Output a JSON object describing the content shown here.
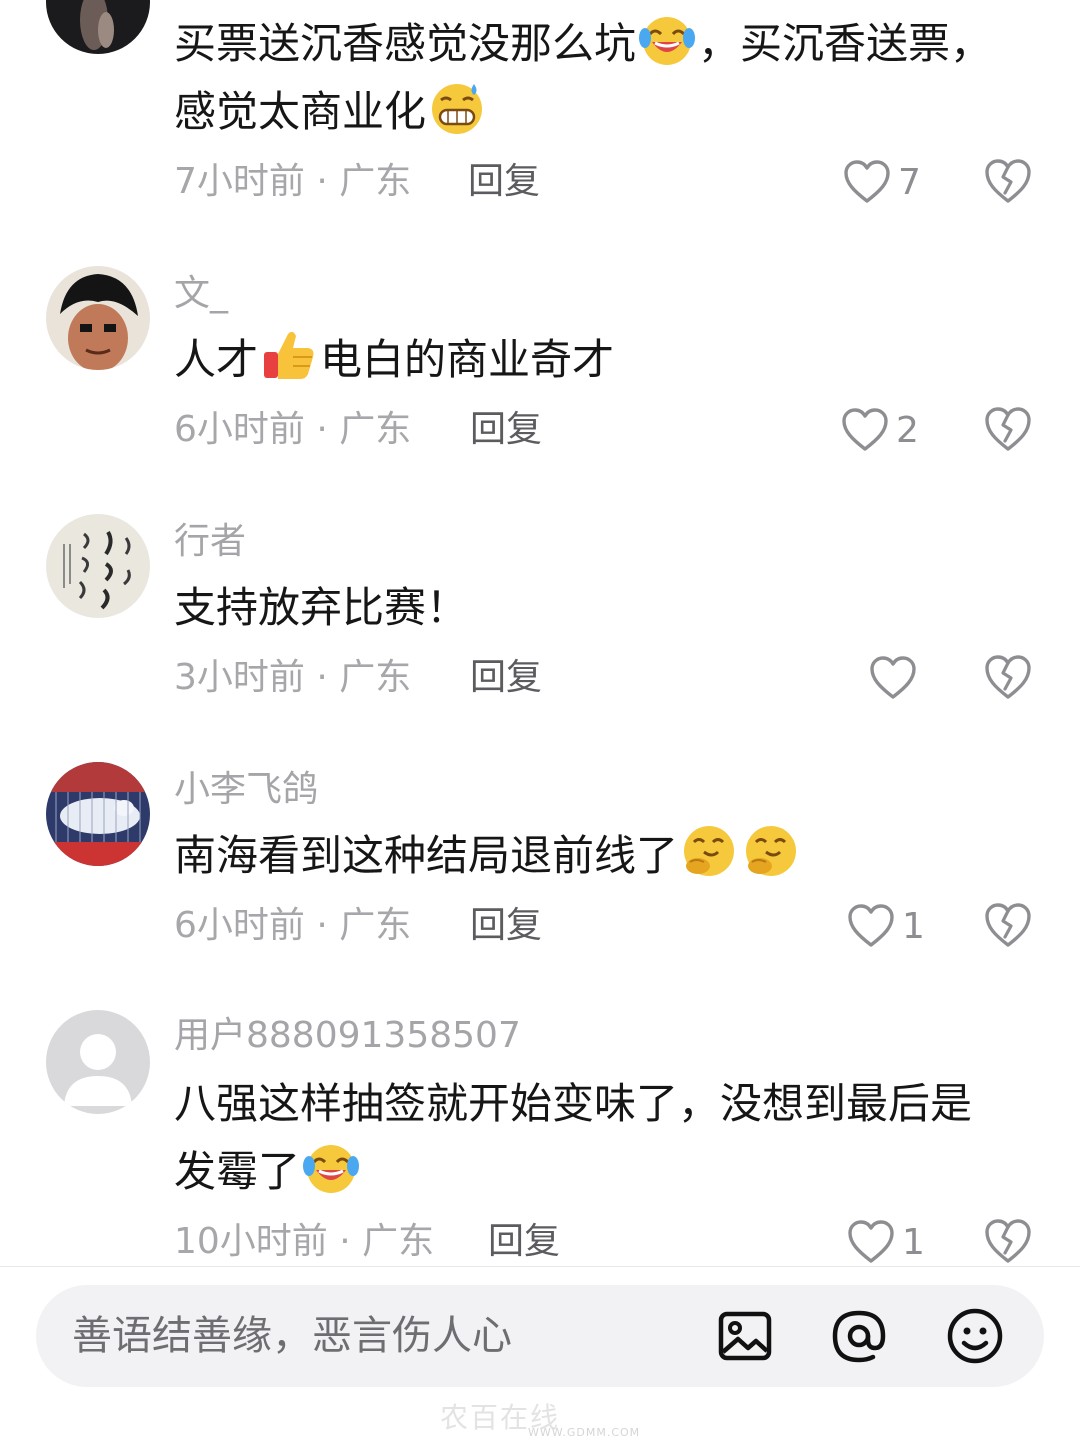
{
  "comments": [
    {
      "username": "",
      "text_parts": [
        "买票送沉香感觉没那么坑",
        "，买沉香送票，",
        "感觉太商业化"
      ],
      "time": "7小时前",
      "location": "广东",
      "reply_label": "回复",
      "likes": "7"
    },
    {
      "username": "文_",
      "text_parts": [
        "人才",
        "电白的商业奇才"
      ],
      "time": "6小时前",
      "location": "广东",
      "reply_label": "回复",
      "likes": "2"
    },
    {
      "username": "行者",
      "text_parts": [
        "支持放弃比赛！"
      ],
      "time": "3小时前",
      "location": "广东",
      "reply_label": "回复",
      "likes": ""
    },
    {
      "username": "小李飞鸽",
      "text_parts": [
        "南海看到这种结局退前线了"
      ],
      "time": "6小时前",
      "location": "广东",
      "reply_label": "回复",
      "likes": "1"
    },
    {
      "username": "用户888091358507",
      "text_parts": [
        "八强这样抽签就开始变味了，没想到最后是",
        "发霉了"
      ],
      "time": "10小时前",
      "location": "广东",
      "reply_label": "回复",
      "likes": "1"
    }
  ],
  "meta_separator": " · ",
  "input": {
    "placeholder": "善语结善缘，恶言伤人心"
  },
  "icons": {
    "like": "heart-outline-icon",
    "dislike": "broken-heart-icon",
    "image": "image-icon",
    "mention": "at-sign-icon",
    "emoji": "smiley-icon"
  },
  "watermark": {
    "text": "农百在线",
    "url": "WWW.GDMM.COM"
  },
  "colors": {
    "text_primary": "#161616",
    "text_secondary": "#a7a7ab",
    "reply": "#5c5c60",
    "input_bg": "#f2f2f4"
  }
}
